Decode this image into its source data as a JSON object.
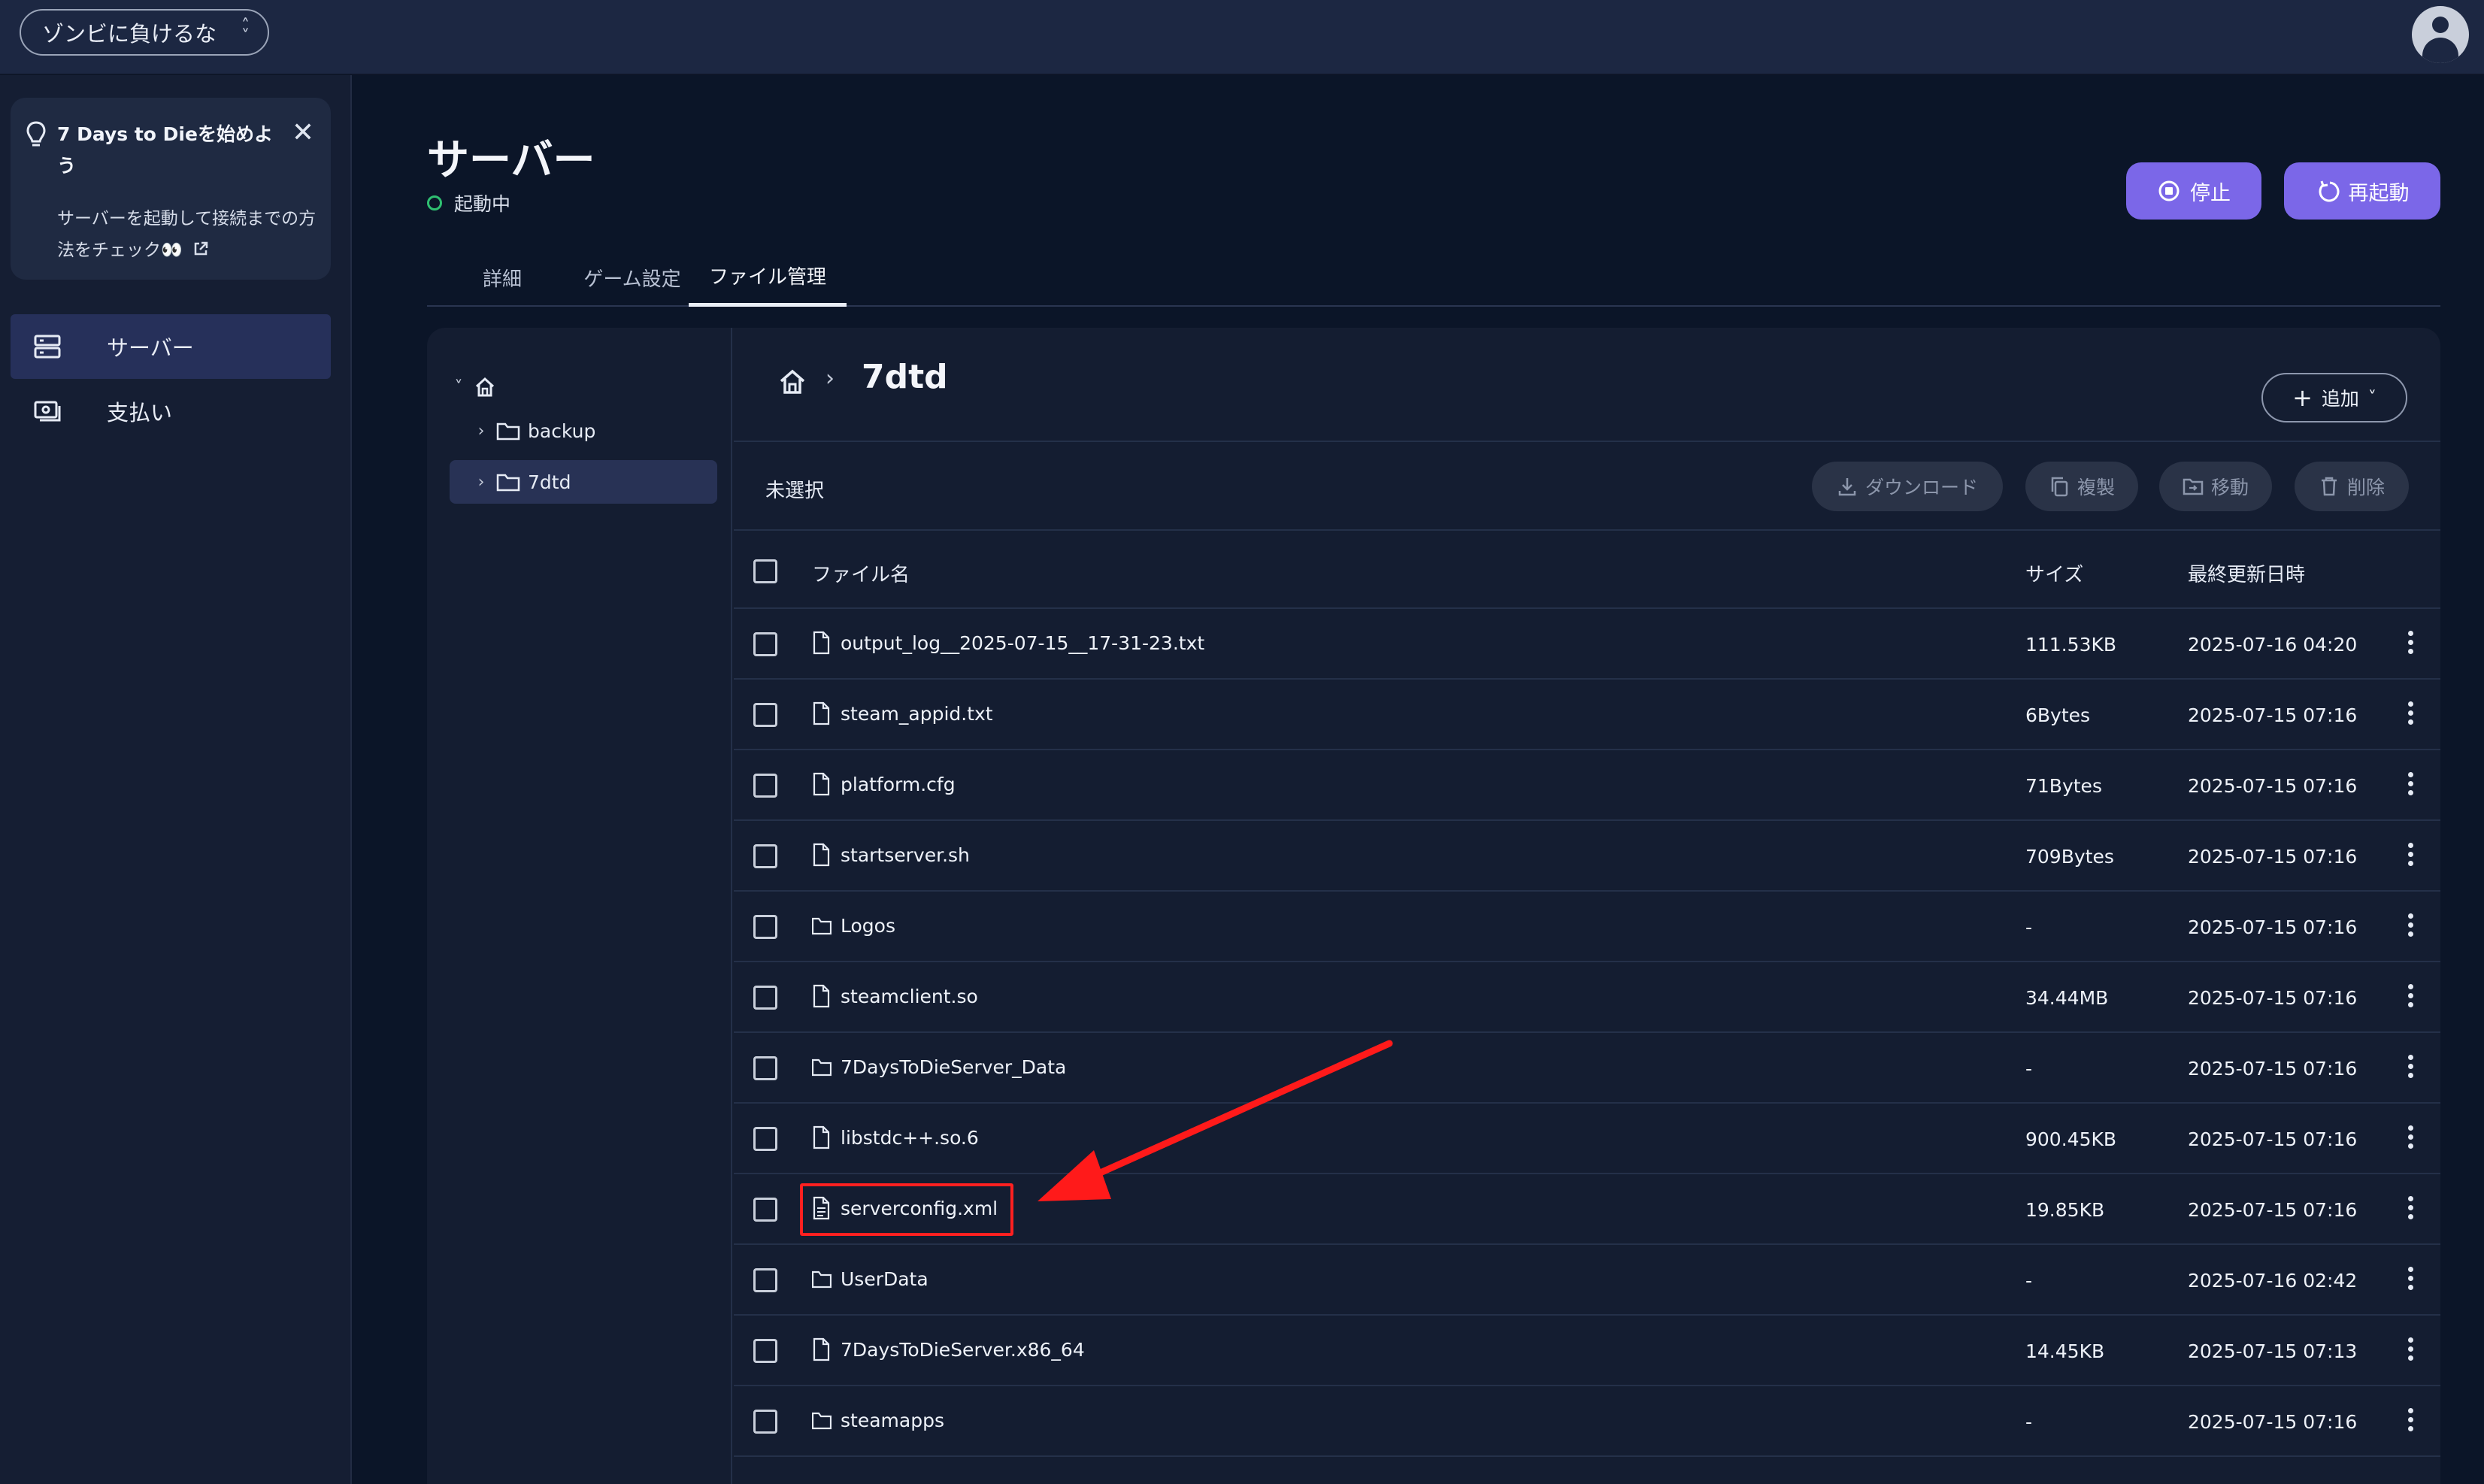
{
  "topbar": {
    "project_name": "ゾンビに負けるな",
    "project_chevron": "⌃⌄"
  },
  "tip": {
    "title": "7 Days to Dieを始めよう",
    "body": "サーバーを起動して接続までの方法をチェック👀"
  },
  "sidebar": {
    "items": [
      {
        "label": "サーバー",
        "icon": "server-icon",
        "active": true
      },
      {
        "label": "支払い",
        "icon": "payment-icon",
        "active": false
      }
    ]
  },
  "header": {
    "title": "サーバー",
    "status": "起動中",
    "status_color": "#2fbf71",
    "stop_label": "停止",
    "restart_label": "再起動",
    "accent": "#7b67e8"
  },
  "tabs": [
    {
      "label": "詳細",
      "active": false
    },
    {
      "label": "ゲーム設定",
      "active": false
    },
    {
      "label": "ファイル管理",
      "active": true
    }
  ],
  "tree": {
    "items": [
      {
        "label": "backup",
        "selected": false
      },
      {
        "label": "7dtd",
        "selected": true
      }
    ]
  },
  "breadcrumb": {
    "separator": "›",
    "current": "7dtd"
  },
  "add_button": {
    "label": "追加"
  },
  "toolbar": {
    "selection": "未選択",
    "download": "ダウンロード",
    "copy": "複製",
    "move": "移動",
    "delete": "削除"
  },
  "table": {
    "headers": {
      "name": "ファイル名",
      "size": "サイズ",
      "modified": "最終更新日時"
    },
    "rows": [
      {
        "name": "output_log__2025-07-15__17-31-23.txt",
        "type": "file",
        "size": "111.53KB",
        "modified": "2025-07-16 04:20"
      },
      {
        "name": "steam_appid.txt",
        "type": "file",
        "size": "6Bytes",
        "modified": "2025-07-15 07:16"
      },
      {
        "name": "platform.cfg",
        "type": "file",
        "size": "71Bytes",
        "modified": "2025-07-15 07:16"
      },
      {
        "name": "startserver.sh",
        "type": "file",
        "size": "709Bytes",
        "modified": "2025-07-15 07:16"
      },
      {
        "name": "Logos",
        "type": "folder",
        "size": "-",
        "modified": "2025-07-15 07:16"
      },
      {
        "name": "steamclient.so",
        "type": "file",
        "size": "34.44MB",
        "modified": "2025-07-15 07:16"
      },
      {
        "name": "7DaysToDieServer_Data",
        "type": "folder",
        "size": "-",
        "modified": "2025-07-15 07:16"
      },
      {
        "name": "libstdc++.so.6",
        "type": "file",
        "size": "900.45KB",
        "modified": "2025-07-15 07:16"
      },
      {
        "name": "serverconfig.xml",
        "type": "doc",
        "size": "19.85KB",
        "modified": "2025-07-15 07:16"
      },
      {
        "name": "UserData",
        "type": "folder",
        "size": "-",
        "modified": "2025-07-16 02:42"
      },
      {
        "name": "7DaysToDieServer.x86_64",
        "type": "file",
        "size": "14.45KB",
        "modified": "2025-07-15 07:13"
      },
      {
        "name": "steamapps",
        "type": "folder",
        "size": "-",
        "modified": "2025-07-15 07:16"
      }
    ]
  },
  "annotation": {
    "color": "#ff2020",
    "target": "serverconfig.xml"
  }
}
